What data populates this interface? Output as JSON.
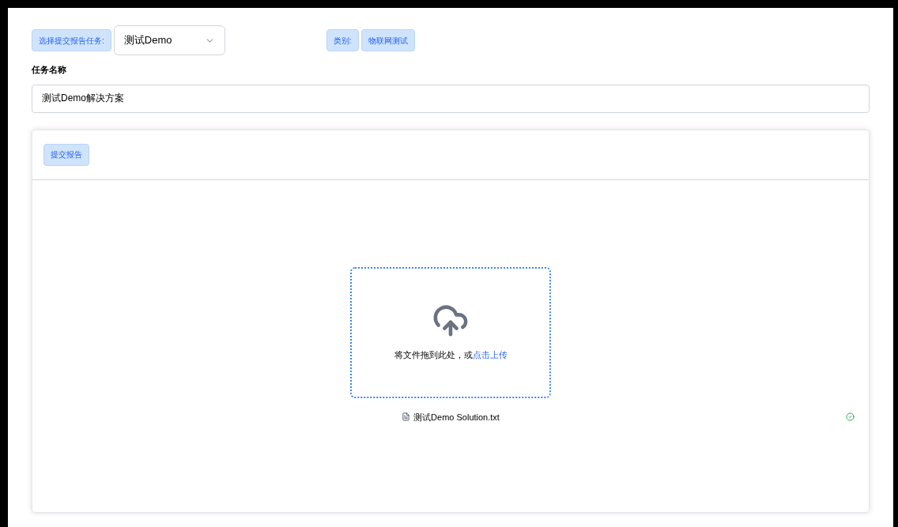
{
  "task_select": {
    "label": "选择提交报告任务:",
    "value": "测试Demo"
  },
  "category": {
    "label": "类别:",
    "value": "物联网测试"
  },
  "task_name": {
    "label": "任务名称",
    "value": "测试Demo解决方案"
  },
  "submit_button": "提交报告",
  "upload": {
    "hint": "将文件拖到此处，或",
    "link": "点击上传"
  },
  "files": [
    {
      "name": "测试Demo Solution.txt",
      "uploaded": true
    }
  ]
}
